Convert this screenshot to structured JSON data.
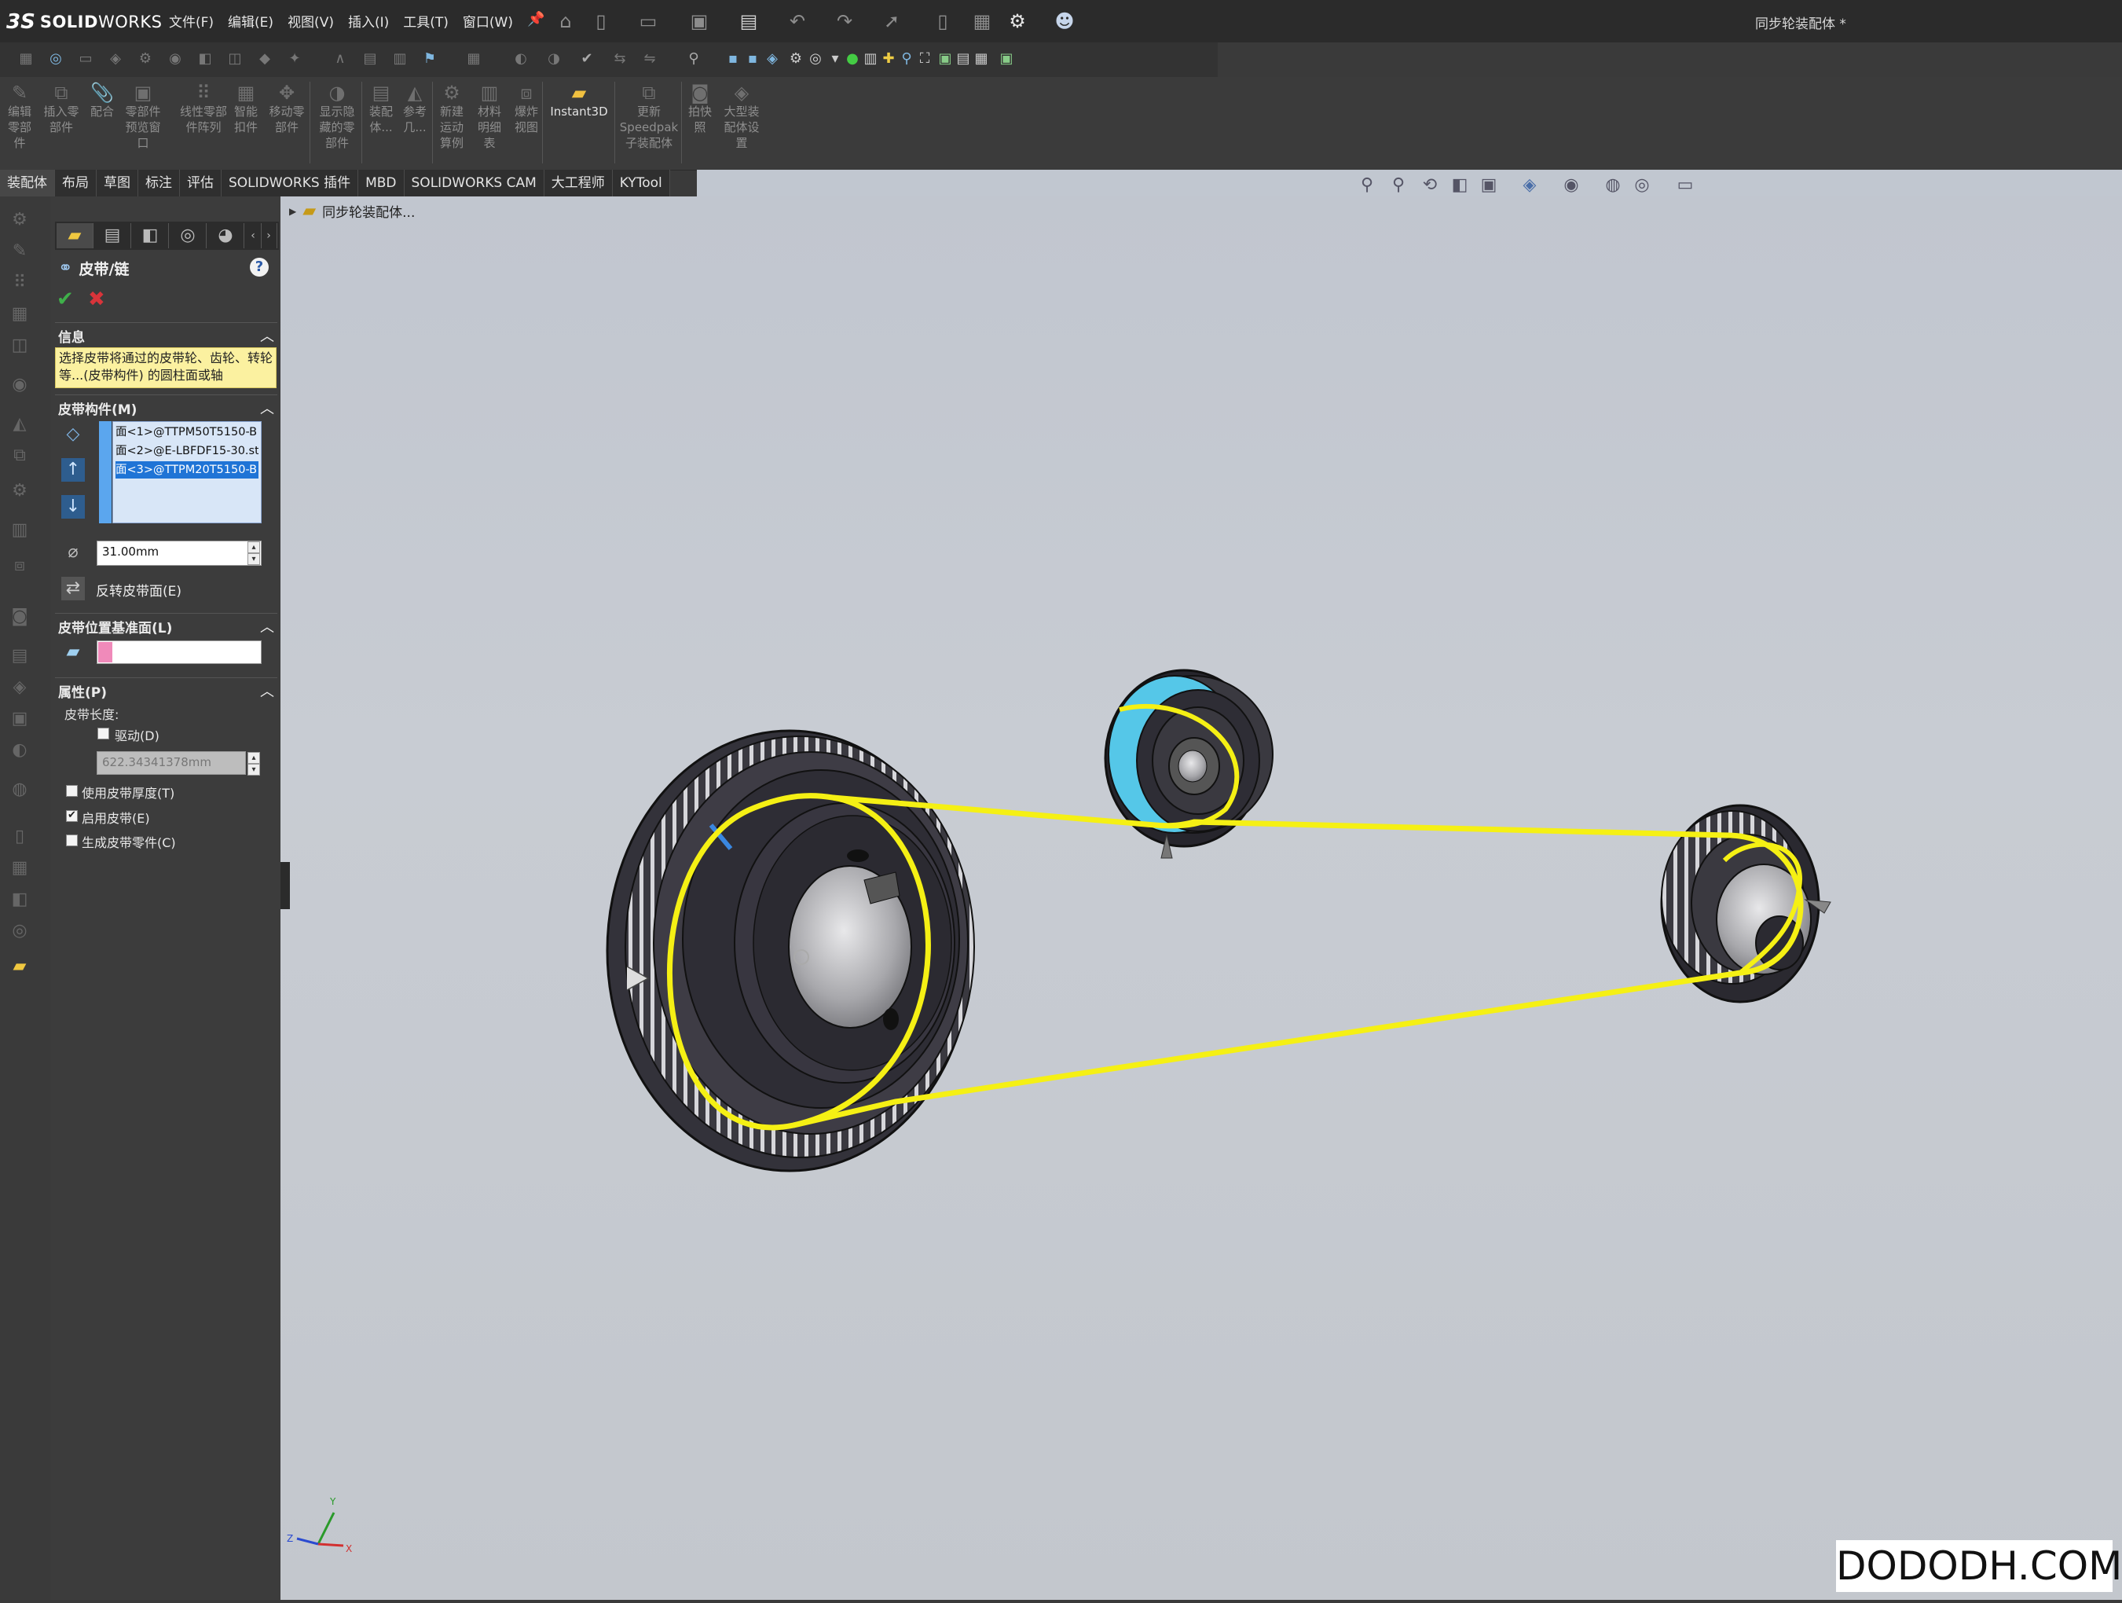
{
  "app": {
    "logo_mark": "3S",
    "logo_bold": "SOLID",
    "logo_light": "WORKS",
    "document_title": "同步轮装配体 *",
    "menus": [
      "文件(F)",
      "编辑(E)",
      "视图(V)",
      "插入(I)",
      "工具(T)",
      "窗口(W)"
    ],
    "pin_icon": "pin-icon"
  },
  "command_manager": {
    "groups": [
      {
        "label": "编辑\n零部\n件",
        "icon": "edit-component-icon"
      },
      {
        "label": "插入零\n部件",
        "icon": "insert-component-icon"
      },
      {
        "label": "配合",
        "icon": "mate-icon"
      },
      {
        "label": "零部件\n预览窗\n口",
        "icon": "component-preview-icon"
      },
      {
        "label": "线性零部\n件阵列",
        "icon": "linear-pattern-icon"
      },
      {
        "label": "智能\n扣件",
        "icon": "smart-fasteners-icon"
      },
      {
        "label": "移动零\n部件",
        "icon": "move-component-icon"
      },
      {
        "label": "显示隐\n藏的零\n部件",
        "icon": "show-hidden-icon"
      },
      {
        "label": "装配\n体...",
        "icon": "assembly-features-icon"
      },
      {
        "label": "参考\n几...",
        "icon": "reference-geometry-icon"
      },
      {
        "label": "新建\n运动\n算例",
        "icon": "motion-study-icon"
      },
      {
        "label": "材料\n明细\n表",
        "icon": "bom-icon"
      },
      {
        "label": "爆炸\n视图",
        "icon": "exploded-view-icon"
      },
      {
        "label": "Instant3D",
        "icon": "instant3d-icon"
      },
      {
        "label": "更新\nSpeedpak\n子装配体",
        "icon": "speedpak-icon"
      },
      {
        "label": "拍快\n照",
        "icon": "snapshot-icon"
      },
      {
        "label": "大型装\n配体设\n置",
        "icon": "large-assembly-icon"
      }
    ]
  },
  "tabs": [
    "装配体",
    "布局",
    "草图",
    "标注",
    "评估",
    "SOLIDWORKS 插件",
    "MBD",
    "SOLIDWORKS CAM",
    "大工程师",
    "KYTool"
  ],
  "active_tab": "装配体",
  "tree": {
    "root_label": "同步轮装配体..."
  },
  "property_manager": {
    "title": "皮带/链",
    "help": "?",
    "ok_icon": "check-icon",
    "cancel_icon": "close-icon",
    "info": {
      "header": "信息",
      "text": "选择皮带将通过的皮带轮、齿轮、转轮等...(皮带构件) 的圆柱面或轴"
    },
    "members": {
      "header": "皮带构件(M)",
      "items": [
        "面<1>@TTPM50T5150-B",
        "面<2>@E-LBFDF15-30.st",
        "面<3>@TTPM20T5150-B"
      ],
      "selected_index": 2,
      "diameter": "31.00mm",
      "reverse_label": "反转皮带面(E)"
    },
    "plane": {
      "header": "皮带位置基准面(L)",
      "value": ""
    },
    "properties": {
      "header": "属性(P)",
      "length_label": "皮带长度:",
      "drive_label": "驱动(D)",
      "drive_checked": false,
      "length_value": "622.34341378mm",
      "options": [
        {
          "label": "使用皮带厚度(T)",
          "checked": false
        },
        {
          "label": "启用皮带(E)",
          "checked": true
        },
        {
          "label": "生成皮带零件(C)",
          "checked": false
        }
      ]
    }
  },
  "triad": {
    "x": "X",
    "y": "Y",
    "z": "Z"
  },
  "watermark": "DODODH.COM",
  "colors": {
    "belt": "#f5f014",
    "viewport": "#c3c8d0",
    "accent_blue": "#1f74d6",
    "info_bg": "#fbf1a0"
  }
}
